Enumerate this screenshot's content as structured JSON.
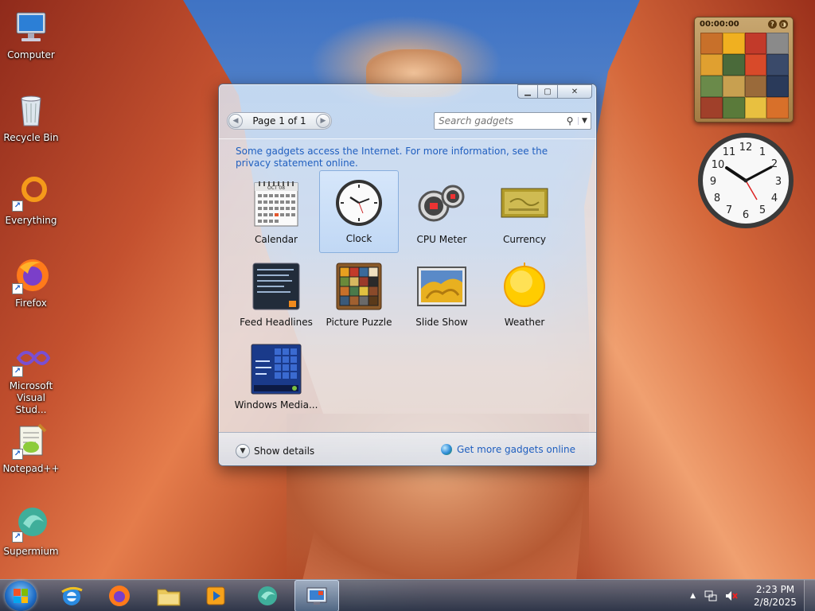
{
  "desktop": {
    "icons": [
      {
        "label": "Computer"
      },
      {
        "label": "Recycle Bin"
      },
      {
        "label": "Everything"
      },
      {
        "label": "Firefox"
      },
      {
        "label": "Microsoft Visual Stud..."
      },
      {
        "label": "Notepad++"
      },
      {
        "label": "Supermium"
      }
    ]
  },
  "gallery": {
    "pager_text": "Page 1 of 1",
    "search_placeholder": "Search gadgets",
    "notice": "Some gadgets access the Internet.  For more information, see the privacy statement online.",
    "gadgets": [
      {
        "label": "Calendar",
        "icon": "calendar-icon"
      },
      {
        "label": "Clock",
        "icon": "clock-icon",
        "selected": true
      },
      {
        "label": "CPU Meter",
        "icon": "cpu-meter-icon"
      },
      {
        "label": "Currency",
        "icon": "currency-icon"
      },
      {
        "label": "Feed Headlines",
        "icon": "feed-headlines-icon"
      },
      {
        "label": "Picture Puzzle",
        "icon": "picture-puzzle-icon"
      },
      {
        "label": "Slide Show",
        "icon": "slide-show-icon"
      },
      {
        "label": "Weather",
        "icon": "weather-icon"
      },
      {
        "label": "Windows Media...",
        "icon": "windows-media-icon"
      }
    ],
    "calendar_month": "OCT 08",
    "show_details": "Show details",
    "get_more": "Get more gadgets online"
  },
  "puzzle_gadget": {
    "timer": "00:00:00"
  },
  "clock_gadget": {
    "numbers": [
      "12",
      "1",
      "2",
      "3",
      "4",
      "5",
      "6",
      "7",
      "8",
      "9",
      "10",
      "11"
    ]
  },
  "taskbar": {
    "apps": [
      {
        "name": "internet-explorer"
      },
      {
        "name": "firefox"
      },
      {
        "name": "file-explorer"
      },
      {
        "name": "media-player"
      },
      {
        "name": "supermium"
      },
      {
        "name": "desktop-gadgets",
        "active": true
      }
    ],
    "time": "2:23 PM",
    "date": "2/8/2025"
  },
  "colors": {
    "link": "#1f5fbf",
    "selection": "#d7e8fc"
  }
}
